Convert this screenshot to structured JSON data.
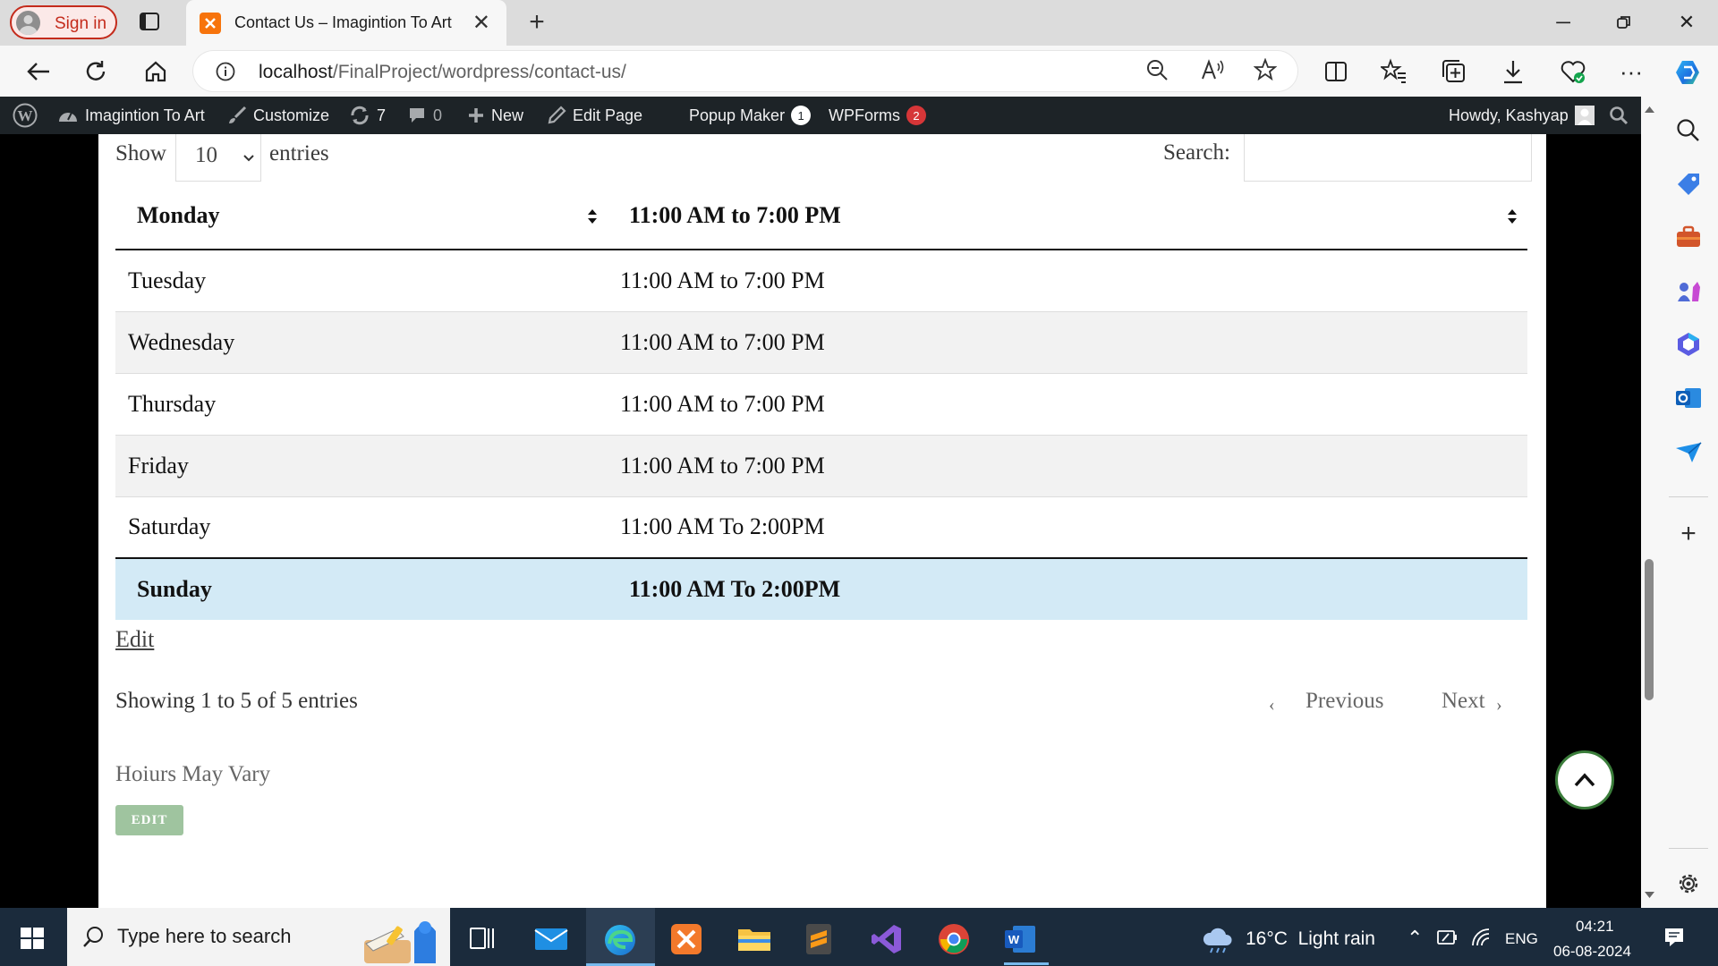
{
  "browser": {
    "sign_in": "Sign in",
    "tab_title": "Contact Us – Imagintion To Art",
    "url_host": "localhost",
    "url_path": "/FinalProject/wordpress/contact-us/"
  },
  "wp_admin_bar": {
    "site_name": "Imagintion To Art",
    "customize": "Customize",
    "updates_count": "7",
    "comments_count": "0",
    "new": "New",
    "edit_page": "Edit Page",
    "popup_maker": "Popup Maker",
    "popup_maker_badge": "1",
    "wpforms": "WPForms",
    "wpforms_badge": "2",
    "howdy": "Howdy, Kashyap"
  },
  "table_controls": {
    "show": "Show",
    "length_value": "10",
    "entries": "entries",
    "search_label": "Search:"
  },
  "hours_table": {
    "header": [
      "Monday",
      "11:00 AM to 7:00 PM"
    ],
    "rows": [
      [
        "Tuesday",
        "11:00 AM to 7:00 PM"
      ],
      [
        "Wednesday",
        "11:00 AM to 7:00 PM"
      ],
      [
        "Thursday",
        "11:00 AM to 7:00 PM"
      ],
      [
        "Friday",
        "11:00 AM to 7:00 PM"
      ],
      [
        "Saturday",
        "11:00 AM To 2:00PM"
      ]
    ],
    "footer": [
      "Sunday",
      "11:00 AM To 2:00PM"
    ]
  },
  "edit_link": "Edit",
  "pagination": {
    "info": "Showing 1 to 5 of 5 entries",
    "previous": "Previous",
    "next": "Next"
  },
  "note": "Hoiurs May Vary",
  "edit_button": "EDIT",
  "taskbar": {
    "search_placeholder": "Type here to search",
    "weather": "16°C  Light rain",
    "language": "ENG",
    "time": "04:21",
    "date": "06-08-2024"
  },
  "colors": {
    "wp_bar": "#1d2327",
    "badge_red": "#d63638",
    "selected_row": "#d3eaf6",
    "edit_button": "#9fc49f",
    "taskbar": "#1b2b3c"
  }
}
